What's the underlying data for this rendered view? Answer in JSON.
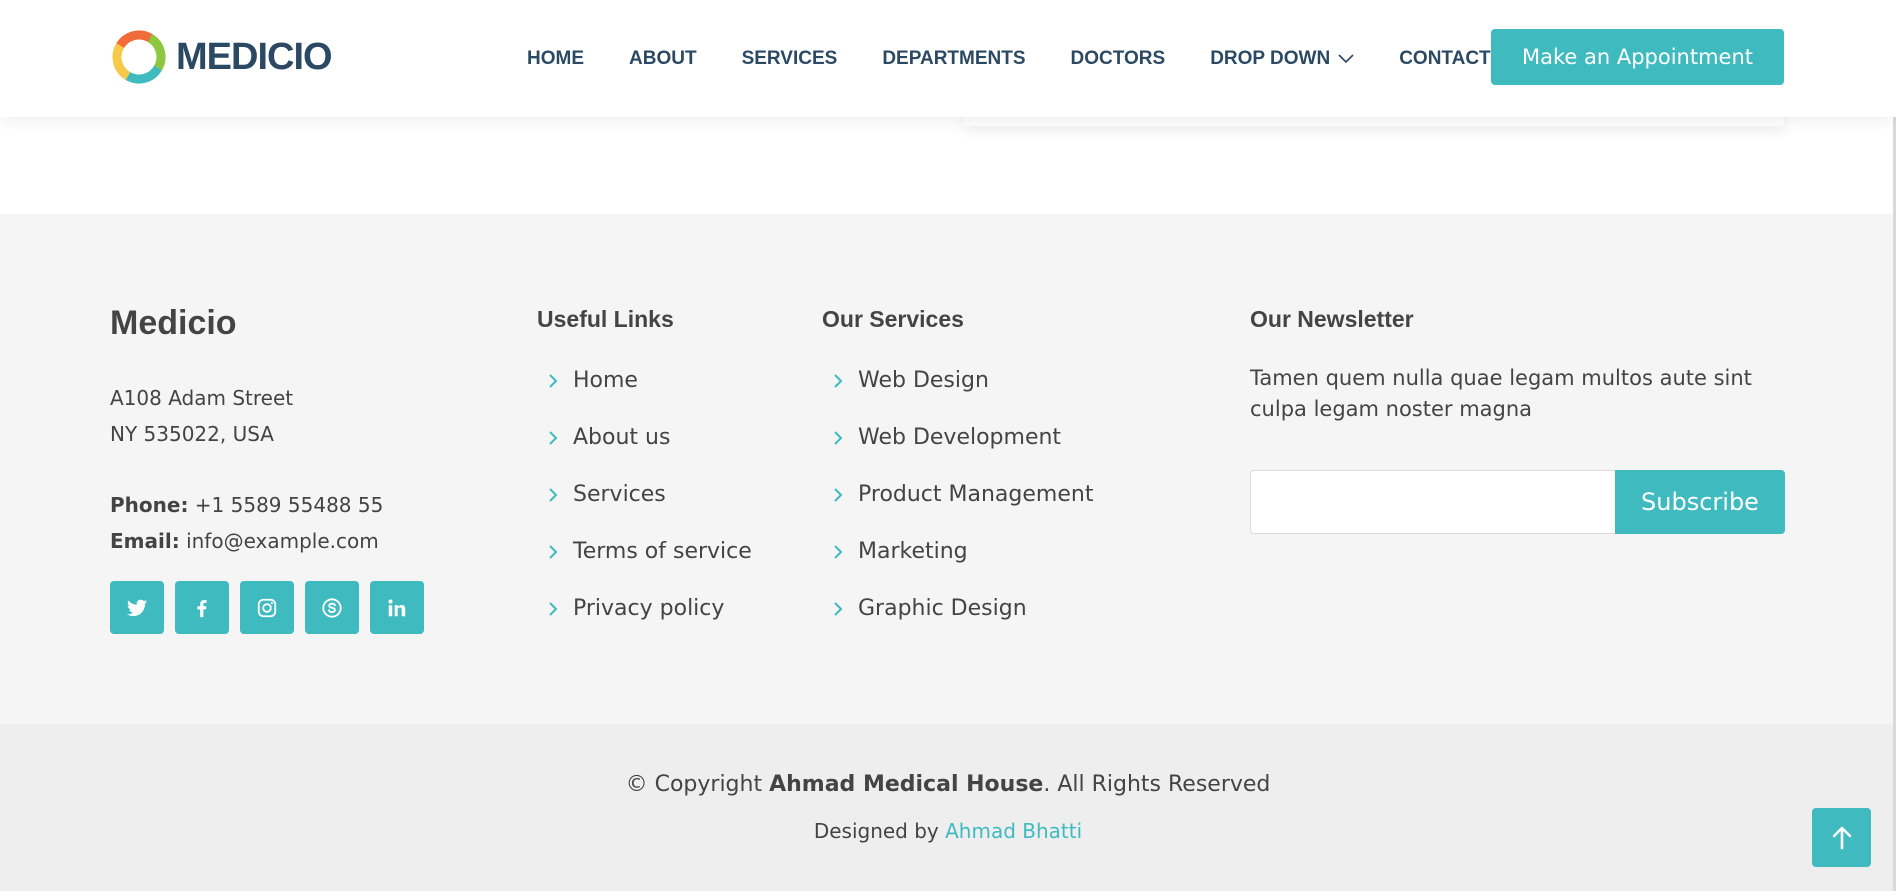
{
  "header": {
    "logo_text": "MEDICIO",
    "nav": [
      {
        "label": "HOME"
      },
      {
        "label": "ABOUT"
      },
      {
        "label": "SERVICES"
      },
      {
        "label": "DEPARTMENTS"
      },
      {
        "label": "DOCTORS"
      },
      {
        "label": "DROP DOWN",
        "icon": "chevron-down-icon"
      },
      {
        "label": "CONTACT"
      }
    ],
    "cta_label": "Make an Appointment"
  },
  "footer": {
    "brand": "Medicio",
    "address_line1": "A108 Adam Street",
    "address_line2": "NY 535022, USA",
    "phone_label": "Phone:",
    "phone": "+1 5589 55488 55",
    "email_label": "Email:",
    "email": "info@example.com",
    "socials": [
      "twitter-icon",
      "facebook-icon",
      "instagram-icon",
      "skype-icon",
      "linkedin-icon"
    ],
    "useful_links": {
      "title": "Useful Links",
      "items": [
        "Home",
        "About us",
        "Services",
        "Terms of service",
        "Privacy policy"
      ]
    },
    "our_services": {
      "title": "Our Services",
      "items": [
        "Web Design",
        "Web Development",
        "Product Management",
        "Marketing",
        "Graphic Design"
      ]
    },
    "newsletter": {
      "title": "Our Newsletter",
      "text": "Tamen quem nulla quae legam multos aute sint culpa legam noster magna",
      "input_value": "",
      "button_label": "Subscribe"
    }
  },
  "bottom": {
    "copyright_prefix": "© Copyright",
    "copyright_owner": "Ahmad Medical House",
    "copyright_suffix": ". All Rights Reserved",
    "designed_by_label": "Designed by",
    "designer": "Ahmad Bhatti"
  },
  "colors": {
    "accent": "#3fbbc0",
    "nav_text": "#2c4964",
    "footer_bg": "#f5f5f5",
    "bottom_bg": "#eeeeee"
  }
}
